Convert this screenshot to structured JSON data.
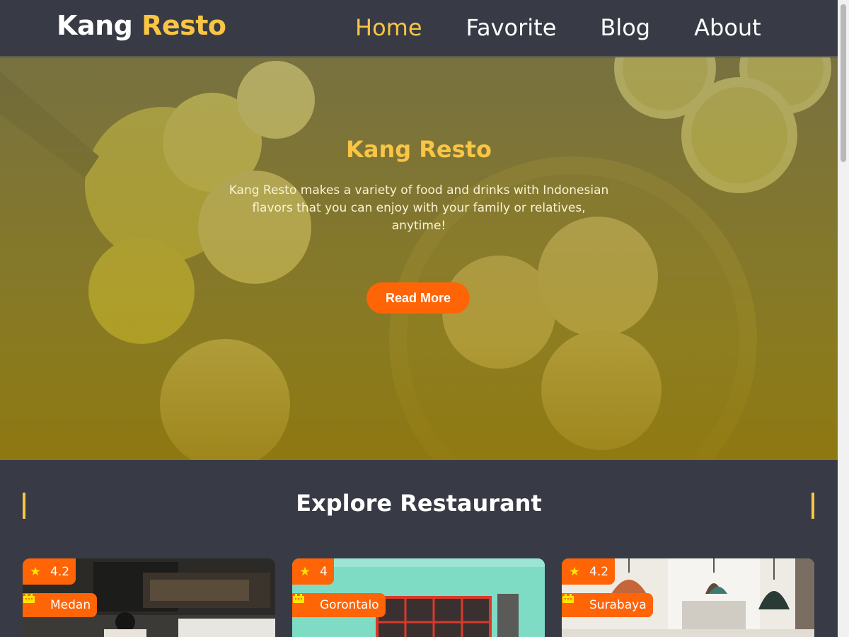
{
  "header": {
    "brand_part1": "Kang",
    "brand_part2": "Resto",
    "nav": [
      {
        "label": "Home"
      },
      {
        "label": "Favorite"
      },
      {
        "label": "Blog"
      },
      {
        "label": "About"
      }
    ]
  },
  "hero": {
    "title": "Kang Resto",
    "description": "Kang Resto makes a variety of food and drinks with Indonesian flavors that you can enjoy with your family or relatives, anytime!",
    "button_label": "Read More"
  },
  "explore": {
    "title": "Explore Restaurant",
    "restaurants": [
      {
        "rating": "4.2",
        "city": "Medan"
      },
      {
        "rating": "4",
        "city": "Gorontalo"
      },
      {
        "rating": "4.2",
        "city": "Surabaya"
      }
    ]
  },
  "colors": {
    "accent": "#f9c544",
    "button": "#ff6407",
    "background": "#383b45"
  }
}
